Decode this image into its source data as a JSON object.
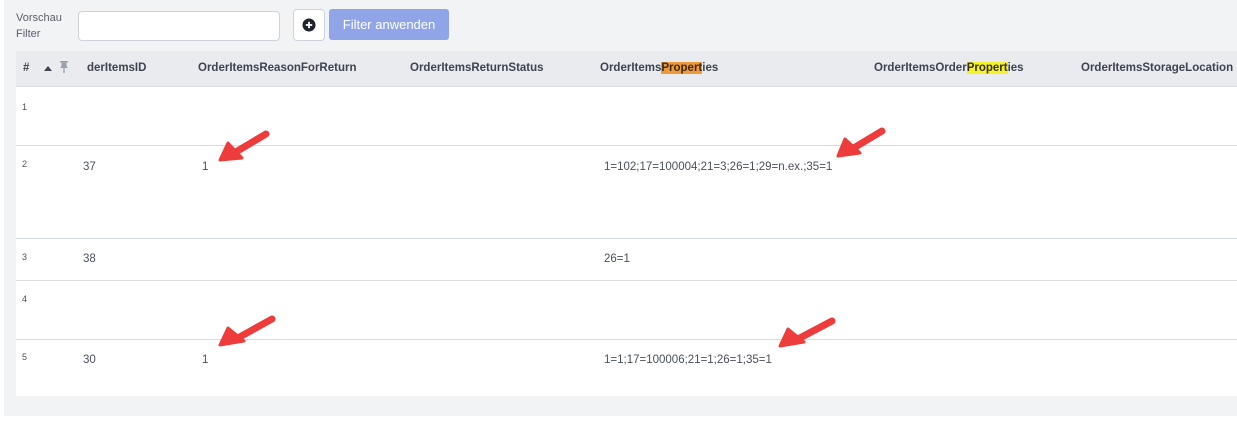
{
  "filter": {
    "label_line1": "Vorschau",
    "label_line2": "Filter",
    "input_value": "",
    "apply_label": "Filter anwenden"
  },
  "table": {
    "columns": {
      "num": "#",
      "id": "derItemsID",
      "reason": "OrderItemsReasonForReturn",
      "status": "OrderItemsReturnStatus",
      "props_pre": "OrderItems",
      "props_hl": "Propert",
      "props_post": "ies",
      "oprops_pre": "OrderItemsOrder",
      "oprops_hl": "Propert",
      "oprops_post": "ies",
      "storage": "OrderItemsStorageLocation"
    },
    "rows": [
      {
        "num": "1",
        "id": "",
        "reason": "",
        "props": ""
      },
      {
        "num": "2",
        "id": "37",
        "reason": "1",
        "props": "1=102;17=100004;21=3;26=1;29=n.ex.;35=1"
      },
      {
        "num": "3",
        "id": "38",
        "reason": "",
        "props": "26=1"
      },
      {
        "num": "4",
        "id": "",
        "reason": "",
        "props": ""
      },
      {
        "num": "5",
        "id": "30",
        "reason": "1",
        "props": "1=1;17=100006;21=1;26=1;35=1"
      }
    ]
  },
  "colors": {
    "accent_button": "#8fa5e8",
    "highlight_orange": "#ee9a3a",
    "highlight_yellow": "#f5f12a",
    "annotation_arrow": "#ee3b3b"
  },
  "icons": [
    "plus-circle-icon",
    "sort-asc-icon",
    "pin-icon",
    "annotation-arrow-icon"
  ]
}
